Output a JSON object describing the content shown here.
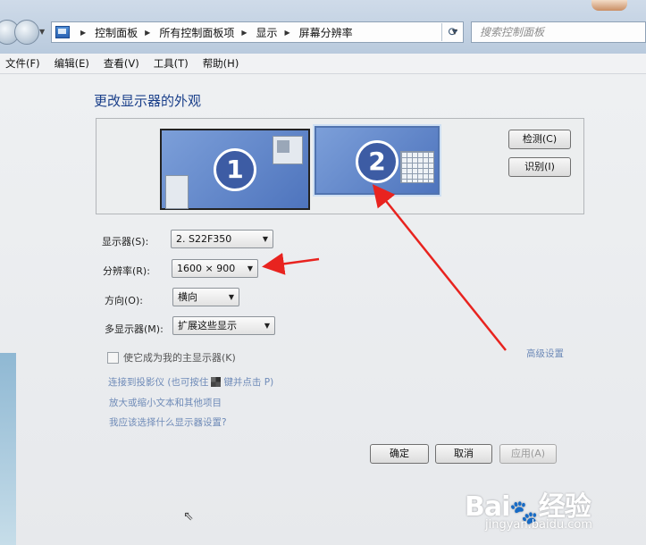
{
  "nav": {
    "breadcrumbs": [
      "控制面板",
      "所有控制面板项",
      "显示",
      "屏幕分辨率"
    ],
    "search_placeholder": "搜索控制面板"
  },
  "menu": [
    "文件(F)",
    "编辑(E)",
    "查看(V)",
    "工具(T)",
    "帮助(H)"
  ],
  "page": {
    "heading": "更改显示器的外观",
    "monitors": [
      {
        "number": "1"
      },
      {
        "number": "2",
        "selected": true
      }
    ],
    "detect_button": "检测(C)",
    "identify_button": "识别(I)",
    "display_label": "显示器(S):",
    "display_value": "2. S22F350",
    "resolution_label": "分辨率(R):",
    "resolution_value": "1600 × 900",
    "orientation_label": "方向(O):",
    "orientation_value": "横向",
    "multi_label": "多显示器(M):",
    "multi_value": "扩展这些显示",
    "primary_checkbox_label": "使它成为我的主显示器(K)",
    "advanced_link": "高级设置",
    "projector_link_before": "连接到投影仪 (也可按住",
    "projector_link_after": "键并点击 P)",
    "text_size_link": "放大或缩小文本和其他项目",
    "which_settings_link": "我应该选择什么显示器设置?",
    "ok_button": "确定",
    "cancel_button": "取消",
    "apply_button": "应用(A)"
  },
  "watermark": {
    "brand_left": "Bai",
    "brand_right": "经验",
    "site": "jingyan.baidu.com"
  },
  "colors": {
    "annotation_arrow": "#e8231f",
    "heading": "#1a3f8a",
    "monitor_fill": "#5b7fc6"
  },
  "icons": [
    "back-arrow-icon",
    "forward-arrow-icon",
    "control-panel-icon",
    "refresh-icon",
    "windows-logo-icon",
    "chevron-down-icon",
    "mouse-cursor-icon",
    "baidu-paw-icon"
  ]
}
